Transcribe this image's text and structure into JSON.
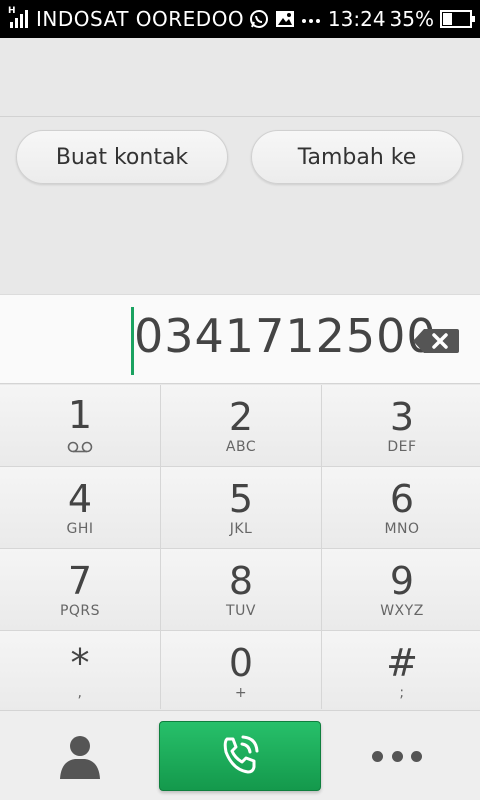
{
  "status_bar": {
    "network_type": "H",
    "carrier": "INDOSAT OOREDOO",
    "icons": [
      "whatsapp-icon",
      "gallery-icon",
      "more-notifications-icon"
    ],
    "time": "13:24",
    "battery_percent": "35%",
    "battery_level": 0.35
  },
  "actions": {
    "create_contact": "Buat kontak",
    "add_to": "Tambah ke"
  },
  "dialer": {
    "number": "0341712500"
  },
  "keypad": [
    {
      "digit": "1",
      "letters": ""
    },
    {
      "digit": "2",
      "letters": "ABC"
    },
    {
      "digit": "3",
      "letters": "DEF"
    },
    {
      "digit": "4",
      "letters": "GHI"
    },
    {
      "digit": "5",
      "letters": "JKL"
    },
    {
      "digit": "6",
      "letters": "MNO"
    },
    {
      "digit": "7",
      "letters": "PQRS"
    },
    {
      "digit": "8",
      "letters": "TUV"
    },
    {
      "digit": "9",
      "letters": "WXYZ"
    },
    {
      "digit": "*",
      "letters": ","
    },
    {
      "digit": "0",
      "letters": "+"
    },
    {
      "digit": "#",
      "letters": ";"
    }
  ],
  "colors": {
    "call_green": "#1aa260",
    "status_bar": "#000000"
  }
}
